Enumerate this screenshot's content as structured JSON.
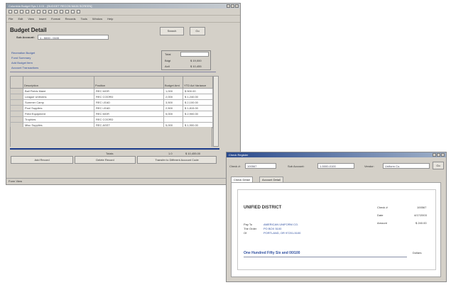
{
  "budget_window": {
    "title": "Columbia Budget Sys 1.0.01 - [BUDGET RECON MAIN SCREEN]",
    "menu": [
      "File",
      "Edit",
      "View",
      "Insert",
      "Format",
      "Records",
      "Tools",
      "Window",
      "Help"
    ],
    "form_title": "Budget Detail",
    "sub_account_label": "Sub Account:",
    "sub_account_value": "1 - 5000 - 0100",
    "search_label": "Search",
    "go_label": "Go",
    "left_fields": [
      "Recreation Budget",
      "Fund Summary",
      "Add Budget Item",
      "Account Transactions"
    ],
    "right_fields": {
      "label1": "Total",
      "value1": "",
      "label2": "Bdgt",
      "value2": "$ 19,000",
      "label3": "Actl",
      "value3": "$ 10,455"
    },
    "table_headers": [
      "Description",
      "Position",
      "Budget Amt",
      "YTD Act Variance"
    ],
    "rows": [
      {
        "desc": "Ball Fields Maint",
        "pos": "REC MGR",
        "amt": "1,000",
        "ytd": "$ 500.00"
      },
      {
        "desc": "League Uniforms",
        "pos": "REC COORD",
        "amt": "2,000",
        "ytd": "$ 1,240.00"
      },
      {
        "desc": "Summer Camp",
        "pos": "REC LEAD",
        "amt": "3,500",
        "ytd": "$ 2,100.00"
      },
      {
        "desc": "Pool Supplies",
        "pos": "REC LEAD",
        "amt": "2,500",
        "ytd": "$ 1,815.00"
      },
      {
        "desc": "Field Equipment",
        "pos": "REC MGR",
        "amt": "5,000",
        "ytd": "$ 2,900.00"
      },
      {
        "desc": "Trophies",
        "pos": "REC COORD",
        "amt": "",
        "ytd": ""
      },
      {
        "desc": "Misc Supplies",
        "pos": "REC ASST",
        "amt": "5,000",
        "ytd": "$ 1,900.00"
      }
    ],
    "totals_label": "Totals",
    "totals_amt": "1.0",
    "totals_ytd": "$ 10,455.00",
    "bottom_buttons": [
      "Add Record",
      "Delete Record",
      "Transfer to Different Account Code"
    ],
    "status": "Form View"
  },
  "check_window": {
    "title": "Check Register",
    "check_label": "Check #:",
    "check_value": "100567",
    "sub_account_label": "Sub Account:",
    "sub_account_value": "1-5000-0100",
    "vendor_label": "Vendor:",
    "vendor_value": "Uniform Co.",
    "go_label": "Go",
    "tabs": [
      "Check Detail",
      "Account Detail"
    ],
    "district": "UNIFIED DISTRICT",
    "pay_to_label": "Pay To\nThe Order\nOf",
    "payee_lines": [
      "AMERICAN UNIFORM CO.",
      "PO BOX 5100",
      "PORTLAND, OR 97201-5100"
    ],
    "meta": [
      {
        "label": "Check #",
        "value": "100567"
      },
      {
        "label": "Date",
        "value": "4/17/2003"
      },
      {
        "label": "Amount",
        "value": "$ 240.00"
      }
    ],
    "amount_words": "One Hundred Fifty Six and 00/100",
    "dollars_label": "Dollars"
  },
  "colors": {
    "window_bg": "#d4d0c8",
    "title_gradient_start": "#2a4a8c",
    "link": "#2f4fa0"
  }
}
